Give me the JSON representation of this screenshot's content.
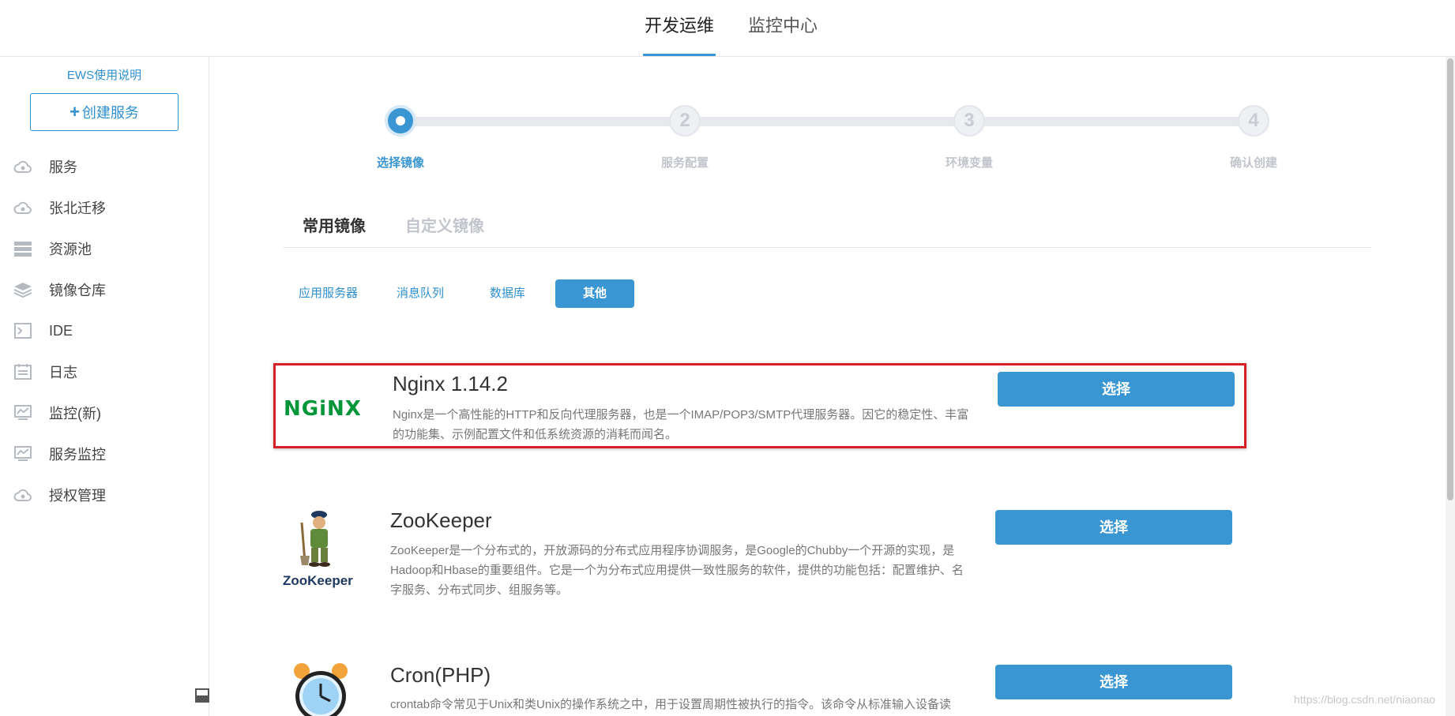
{
  "header": {
    "tabs": [
      {
        "label": "开发运维",
        "active": true
      },
      {
        "label": "监控中心",
        "active": false
      }
    ]
  },
  "sidebar": {
    "help_link": "EWS使用说明",
    "create_button": {
      "icon": "plus-icon",
      "label": "创建服务"
    },
    "items": [
      {
        "label": "服务",
        "icon": "cloud-icon"
      },
      {
        "label": "张北迁移",
        "icon": "cloud-icon"
      },
      {
        "label": "资源池",
        "icon": "server-stack-icon"
      },
      {
        "label": "镜像仓库",
        "icon": "layers-icon"
      },
      {
        "label": "IDE",
        "icon": "terminal-icon"
      },
      {
        "label": "日志",
        "icon": "log-icon"
      },
      {
        "label": "监控(新)",
        "icon": "monitor-icon"
      },
      {
        "label": "服务监控",
        "icon": "monitor-icon"
      },
      {
        "label": "授权管理",
        "icon": "cloud-icon"
      }
    ]
  },
  "stepper": {
    "steps": [
      {
        "number": "1",
        "label": "选择镜像",
        "active": true
      },
      {
        "number": "2",
        "label": "服务配置",
        "active": false
      },
      {
        "number": "3",
        "label": "环境变量",
        "active": false
      },
      {
        "number": "4",
        "label": "确认创建",
        "active": false
      }
    ]
  },
  "image_tabs": [
    {
      "label": "常用镜像",
      "active": true
    },
    {
      "label": "自定义镜像",
      "active": false
    }
  ],
  "categories": [
    {
      "label": "应用服务器",
      "active": false
    },
    {
      "label": "消息队列",
      "active": false
    },
    {
      "label": "数据库",
      "active": false
    },
    {
      "label": "其他",
      "active": true
    }
  ],
  "images": [
    {
      "name": "Nginx 1.14.2",
      "logo_text": "NGiNX",
      "description": "Nginx是一个高性能的HTTP和反向代理服务器，也是一个IMAP/POP3/SMTP代理服务器。因它的稳定性、丰富的功能集、示例配置文件和低系统资源的消耗而闻名。",
      "button": "选择",
      "highlighted": true
    },
    {
      "name": "ZooKeeper",
      "logo_text": "ZooKeeper",
      "description": "ZooKeeper是一个分布式的，开放源码的分布式应用程序协调服务，是Google的Chubby一个开源的实现，是Hadoop和Hbase的重要组件。它是一个为分布式应用提供一致性服务的软件，提供的功能包括：配置维护、名字服务、分布式同步、组服务等。",
      "button": "选择",
      "highlighted": false
    },
    {
      "name": "Cron(PHP)",
      "logo_text": "",
      "description": "crontab命令常见于Unix和类Unix的操作系统之中，用于设置周期性被执行的指令。该命令从标准输入设备读",
      "button": "选择",
      "highlighted": false
    }
  ],
  "watermark": "https://blog.csdn.net/niaonao",
  "colors": {
    "accent": "#3a96d2",
    "link": "#2f8fcf",
    "highlight_border": "#d61f26",
    "nginx_green": "#009639"
  }
}
